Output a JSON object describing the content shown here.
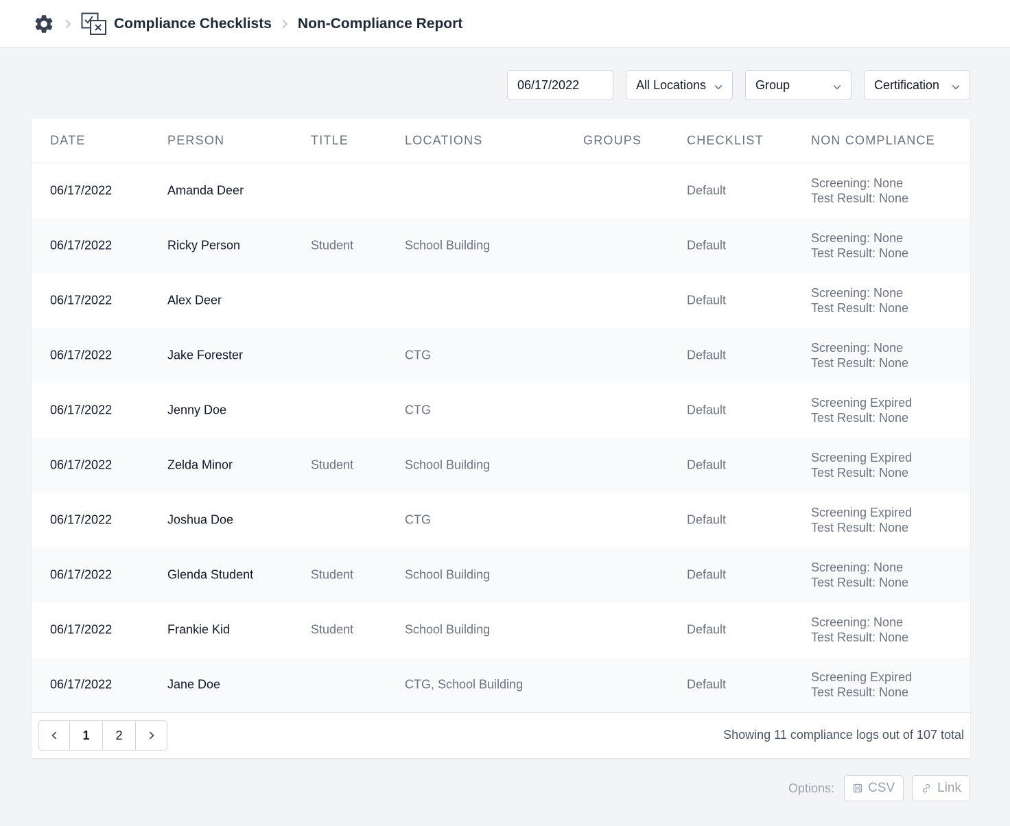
{
  "breadcrumb": {
    "section": "Compliance Checklists",
    "page": "Non-Compliance Report"
  },
  "filters": {
    "date": "06/17/2022",
    "locations": "All Locations",
    "group": "Group",
    "certification": "Certification"
  },
  "table": {
    "headers": [
      "DATE",
      "PERSON",
      "TITLE",
      "LOCATIONS",
      "GROUPS",
      "CHECKLIST",
      "NON COMPLIANCE"
    ],
    "rows": [
      {
        "date": "06/17/2022",
        "person": "Amanda Deer",
        "title": "",
        "locations": "",
        "groups": "",
        "checklist": "Default",
        "nc1": "Screening: None",
        "nc2": "Test Result: None"
      },
      {
        "date": "06/17/2022",
        "person": "Ricky Person",
        "title": "Student",
        "locations": "School Building",
        "groups": "",
        "checklist": "Default",
        "nc1": "Screening: None",
        "nc2": "Test Result: None"
      },
      {
        "date": "06/17/2022",
        "person": "Alex Deer",
        "title": "",
        "locations": "",
        "groups": "",
        "checklist": "Default",
        "nc1": "Screening: None",
        "nc2": "Test Result: None"
      },
      {
        "date": "06/17/2022",
        "person": "Jake Forester",
        "title": "",
        "locations": "CTG",
        "groups": "",
        "checklist": "Default",
        "nc1": "Screening: None",
        "nc2": "Test Result: None"
      },
      {
        "date": "06/17/2022",
        "person": "Jenny Doe",
        "title": "",
        "locations": "CTG",
        "groups": "",
        "checklist": "Default",
        "nc1": "Screening Expired",
        "nc2": "Test Result: None"
      },
      {
        "date": "06/17/2022",
        "person": "Zelda Minor",
        "title": "Student",
        "locations": "School Building",
        "groups": "",
        "checklist": "Default",
        "nc1": "Screening Expired",
        "nc2": "Test Result: None"
      },
      {
        "date": "06/17/2022",
        "person": "Joshua Doe",
        "title": "",
        "locations": "CTG",
        "groups": "",
        "checklist": "Default",
        "nc1": "Screening Expired",
        "nc2": "Test Result: None"
      },
      {
        "date": "06/17/2022",
        "person": "Glenda Student",
        "title": "Student",
        "locations": "School Building",
        "groups": "",
        "checklist": "Default",
        "nc1": "Screening: None",
        "nc2": "Test Result: None"
      },
      {
        "date": "06/17/2022",
        "person": "Frankie Kid",
        "title": "Student",
        "locations": "School Building",
        "groups": "",
        "checklist": "Default",
        "nc1": "Screening: None",
        "nc2": "Test Result: None"
      },
      {
        "date": "06/17/2022",
        "person": "Jane Doe",
        "title": "",
        "locations": "CTG, School Building",
        "groups": "",
        "checklist": "Default",
        "nc1": "Screening Expired",
        "nc2": "Test Result: None"
      }
    ]
  },
  "pagination": {
    "pages": [
      "1",
      "2"
    ],
    "showing": "Showing 11 compliance logs out of 107 total"
  },
  "options": {
    "label": "Options:",
    "csv": "CSV",
    "link": "Link"
  },
  "icons": {
    "settings": "gear-icon",
    "checklist": "checklist-icon",
    "separator": "chevron-right-icon"
  }
}
